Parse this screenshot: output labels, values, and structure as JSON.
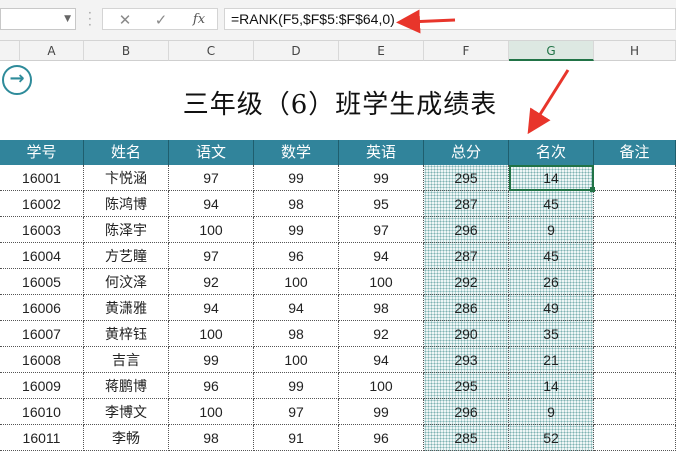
{
  "formula_bar": {
    "name_box": "",
    "cancel_icon": "✕",
    "confirm_icon": "✓",
    "fx_label": "fx",
    "formula": "=RANK(F5,$F$5:$F$64,0)"
  },
  "columns": [
    "A",
    "B",
    "C",
    "D",
    "E",
    "F",
    "G",
    "H"
  ],
  "selected_column": "G",
  "title": "三年级（6）班学生成绩表",
  "headers": [
    "学号",
    "姓名",
    "语文",
    "数学",
    "英语",
    "总分",
    "名次",
    "备注"
  ],
  "rows": [
    [
      "16001",
      "卞悦涵",
      "97",
      "99",
      "99",
      "295",
      "14",
      ""
    ],
    [
      "16002",
      "陈鸿博",
      "94",
      "98",
      "95",
      "287",
      "45",
      ""
    ],
    [
      "16003",
      "陈泽宇",
      "100",
      "99",
      "97",
      "296",
      "9",
      ""
    ],
    [
      "16004",
      "方艺瞳",
      "97",
      "96",
      "94",
      "287",
      "45",
      ""
    ],
    [
      "16005",
      "何汶泽",
      "92",
      "100",
      "100",
      "292",
      "26",
      ""
    ],
    [
      "16006",
      "黄潇雅",
      "94",
      "94",
      "98",
      "286",
      "49",
      ""
    ],
    [
      "16007",
      "黄梓钰",
      "100",
      "98",
      "92",
      "290",
      "35",
      ""
    ],
    [
      "16008",
      "吉言",
      "99",
      "100",
      "94",
      "293",
      "21",
      ""
    ],
    [
      "16009",
      "蒋鹏博",
      "96",
      "99",
      "100",
      "295",
      "14",
      ""
    ],
    [
      "16010",
      "李博文",
      "100",
      "97",
      "99",
      "296",
      "9",
      ""
    ],
    [
      "16011",
      "李畅",
      "98",
      "91",
      "96",
      "285",
      "52",
      ""
    ]
  ],
  "colors": {
    "header_bg": "#31849b",
    "excel_green": "#217346",
    "arrow_red": "#e8352b"
  }
}
